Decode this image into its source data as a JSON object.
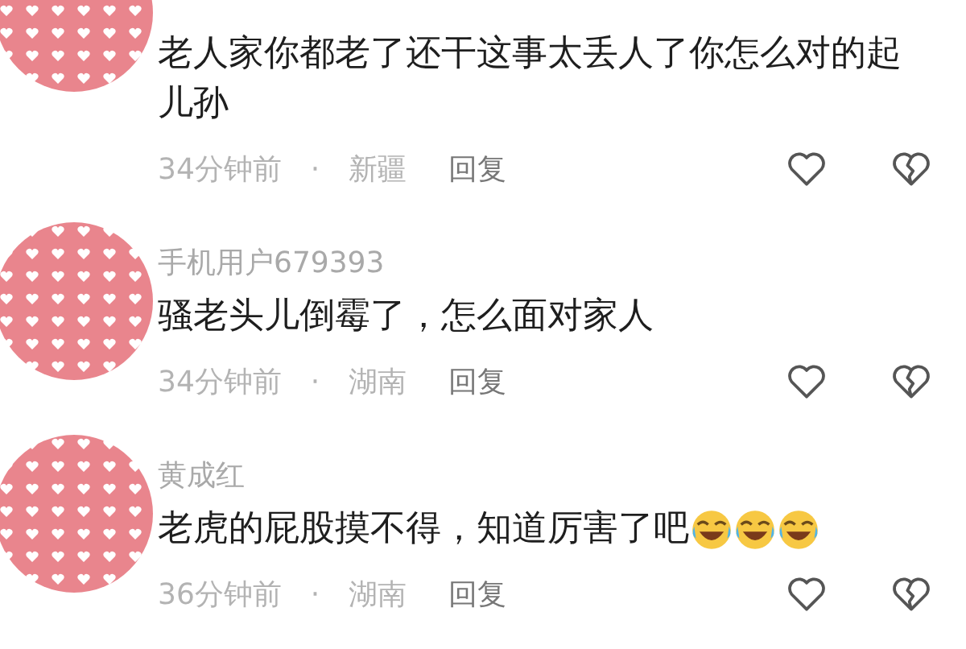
{
  "comments": [
    {
      "text": "老人家你都老了还干这事太丢人了你怎么对的起儿孙",
      "time": "34分钟前",
      "separator": "·",
      "region": "新疆",
      "reply": "回复"
    },
    {
      "name": "手机用户679393",
      "text": "骚老头儿倒霉了，怎么面对家人",
      "time": "34分钟前",
      "separator": "·",
      "region": "湖南",
      "reply": "回复"
    },
    {
      "name": "黄成红",
      "text": "老虎的屁股摸不得，知道厉害了吧",
      "emojis": [
        {
          "kind": "tears-of-joy"
        },
        {
          "kind": "tears-of-joy"
        },
        {
          "kind": "tears-of-joy"
        }
      ],
      "time": "36分钟前",
      "separator": "·",
      "region": "湖南",
      "reply": "回复"
    }
  ]
}
